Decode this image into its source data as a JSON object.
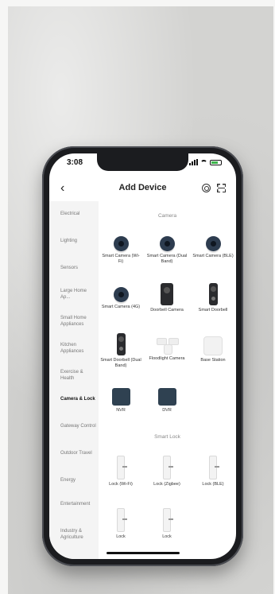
{
  "status": {
    "time": "3:08"
  },
  "header": {
    "title": "Add Device"
  },
  "sidebar": {
    "items": [
      {
        "label": "Electrical"
      },
      {
        "label": "Lighting"
      },
      {
        "label": "Sensors"
      },
      {
        "label": "Large Home Ap..."
      },
      {
        "label": "Small Home Appliances"
      },
      {
        "label": "Kitchen Appliances"
      },
      {
        "label": "Exercise & Health"
      },
      {
        "label": "Camera & Lock",
        "active": true
      },
      {
        "label": "Gateway Control"
      },
      {
        "label": "Outdoor Travel"
      },
      {
        "label": "Energy"
      },
      {
        "label": "Entertainment"
      },
      {
        "label": "Industry & Agriculture"
      }
    ]
  },
  "sections": {
    "camera": "Camera",
    "smart_lock": "Smart Lock"
  },
  "devices": [
    {
      "label": "Smart Camera (Wi-Fi)",
      "icon": "camera-icon"
    },
    {
      "label": "Smart Camera (Dual Band)",
      "icon": "camera-icon"
    },
    {
      "label": "Smart Camera (BLE)",
      "icon": "camera-icon"
    },
    {
      "label": "Smart Camera (4G)",
      "icon": "camera-icon"
    },
    {
      "label": "Doorbell Camera",
      "icon": "doorbell-icon"
    },
    {
      "label": "Smart Doorbell",
      "icon": "doorbell-icon"
    },
    {
      "label": "Smart Doorbell (Dual Band)",
      "icon": "doorbell-icon"
    },
    {
      "label": "Floodlight Camera",
      "icon": "floodlight-icon"
    },
    {
      "label": "Base Station",
      "icon": "base-station-icon"
    },
    {
      "label": "NVR",
      "icon": "nvr-icon"
    },
    {
      "label": "DVR",
      "icon": "dvr-icon"
    }
  ],
  "locks": [
    {
      "label": "Lock (Wi-Fi)",
      "icon": "lock-icon"
    },
    {
      "label": "Lock (Zigbee)",
      "icon": "lock-icon"
    },
    {
      "label": "Lock (BLE)",
      "icon": "lock-icon"
    },
    {
      "label": "Lock",
      "icon": "lock-icon"
    },
    {
      "label": "Lock",
      "icon": "lock-icon"
    }
  ],
  "colors": {
    "battery": "#3bb44a",
    "camera": "#2d3c4f"
  }
}
